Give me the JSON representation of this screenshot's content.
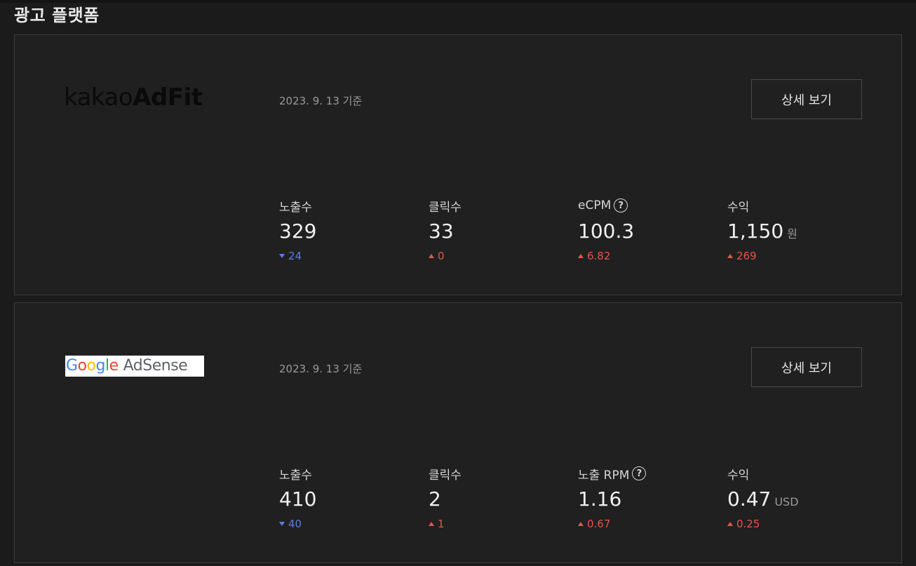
{
  "section_title": "광고 플랫폼",
  "platforms": [
    {
      "logo_brand": "kakao",
      "logo_product": "AdFit",
      "date": "2023. 9. 13 기준",
      "detail_label": "상세 보기",
      "metrics": [
        {
          "label": "노출수",
          "value": "329",
          "unit": "",
          "delta": "24",
          "direction": "down"
        },
        {
          "label": "클릭수",
          "value": "33",
          "unit": "",
          "delta": "0",
          "direction": "up"
        },
        {
          "label": "eCPM",
          "value": "100.3",
          "unit": "",
          "delta": "6.82",
          "direction": "up",
          "help": "?"
        },
        {
          "label": "수익",
          "value": "1,150",
          "unit": "원",
          "delta": "269",
          "direction": "up"
        }
      ]
    },
    {
      "logo_letters": [
        "G",
        "o",
        "o",
        "g",
        "l",
        "e"
      ],
      "logo_product": "AdSense",
      "date": "2023. 9. 13 기준",
      "detail_label": "상세 보기",
      "metrics": [
        {
          "label": "노출수",
          "value": "410",
          "unit": "",
          "delta": "40",
          "direction": "down"
        },
        {
          "label": "클릭수",
          "value": "2",
          "unit": "",
          "delta": "1",
          "direction": "up"
        },
        {
          "label": "노출 RPM",
          "value": "1.16",
          "unit": "",
          "delta": "0.67",
          "direction": "up",
          "help": "?"
        },
        {
          "label": "수익",
          "value": "0.47",
          "unit": "USD",
          "delta": "0.25",
          "direction": "up"
        }
      ]
    }
  ],
  "colors": {
    "delta_down": "#5b7fe0",
    "delta_up": "#e8534a",
    "google_blue": "#4285f4",
    "google_red": "#ea4335",
    "google_yellow": "#fbbc05",
    "google_green": "#34a853"
  },
  "icons": {
    "help": "help-circle-icon",
    "delta_down": "triangle-down-icon",
    "delta_up": "triangle-up-icon"
  }
}
